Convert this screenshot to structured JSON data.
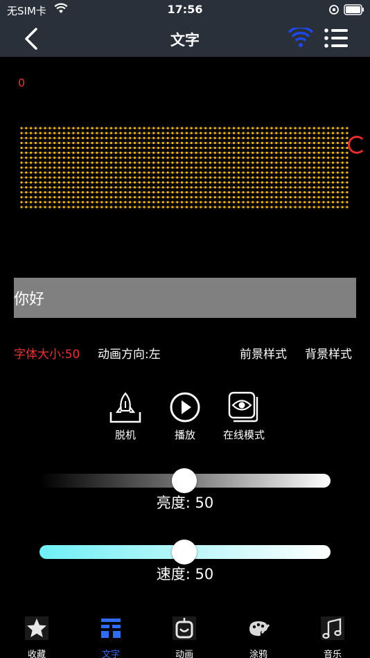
{
  "status": {
    "carrier": "无SIM卡",
    "time": "17:56"
  },
  "nav": {
    "title": "文字"
  },
  "preview": {
    "counter": "0",
    "led_rows": 17,
    "led_cols": 70,
    "led_color": "#f2b81a",
    "grid_color": "#8a5a3a"
  },
  "text_input": {
    "value": "你好"
  },
  "options": {
    "font_size": "字体大小:50",
    "direction": "动画方向:左",
    "foreground": "前景样式",
    "background": "背景样式"
  },
  "actions": {
    "offline": "脱机",
    "play": "播放",
    "online": "在线模式"
  },
  "sliders": {
    "brightness_label": "亮度: 50",
    "brightness_value": 50,
    "speed_label": "速度: 50",
    "speed_value": 50
  },
  "tabs": [
    {
      "label": "收藏",
      "icon": "star-icon"
    },
    {
      "label": "文字",
      "icon": "text-icon"
    },
    {
      "label": "动画",
      "icon": "animation-icon"
    },
    {
      "label": "涂鸦",
      "icon": "palette-icon"
    },
    {
      "label": "音乐",
      "icon": "music-icon"
    }
  ],
  "colors": {
    "accent": "#2f6cf6",
    "highlight": "#e63333",
    "bar": "#2a303a"
  }
}
